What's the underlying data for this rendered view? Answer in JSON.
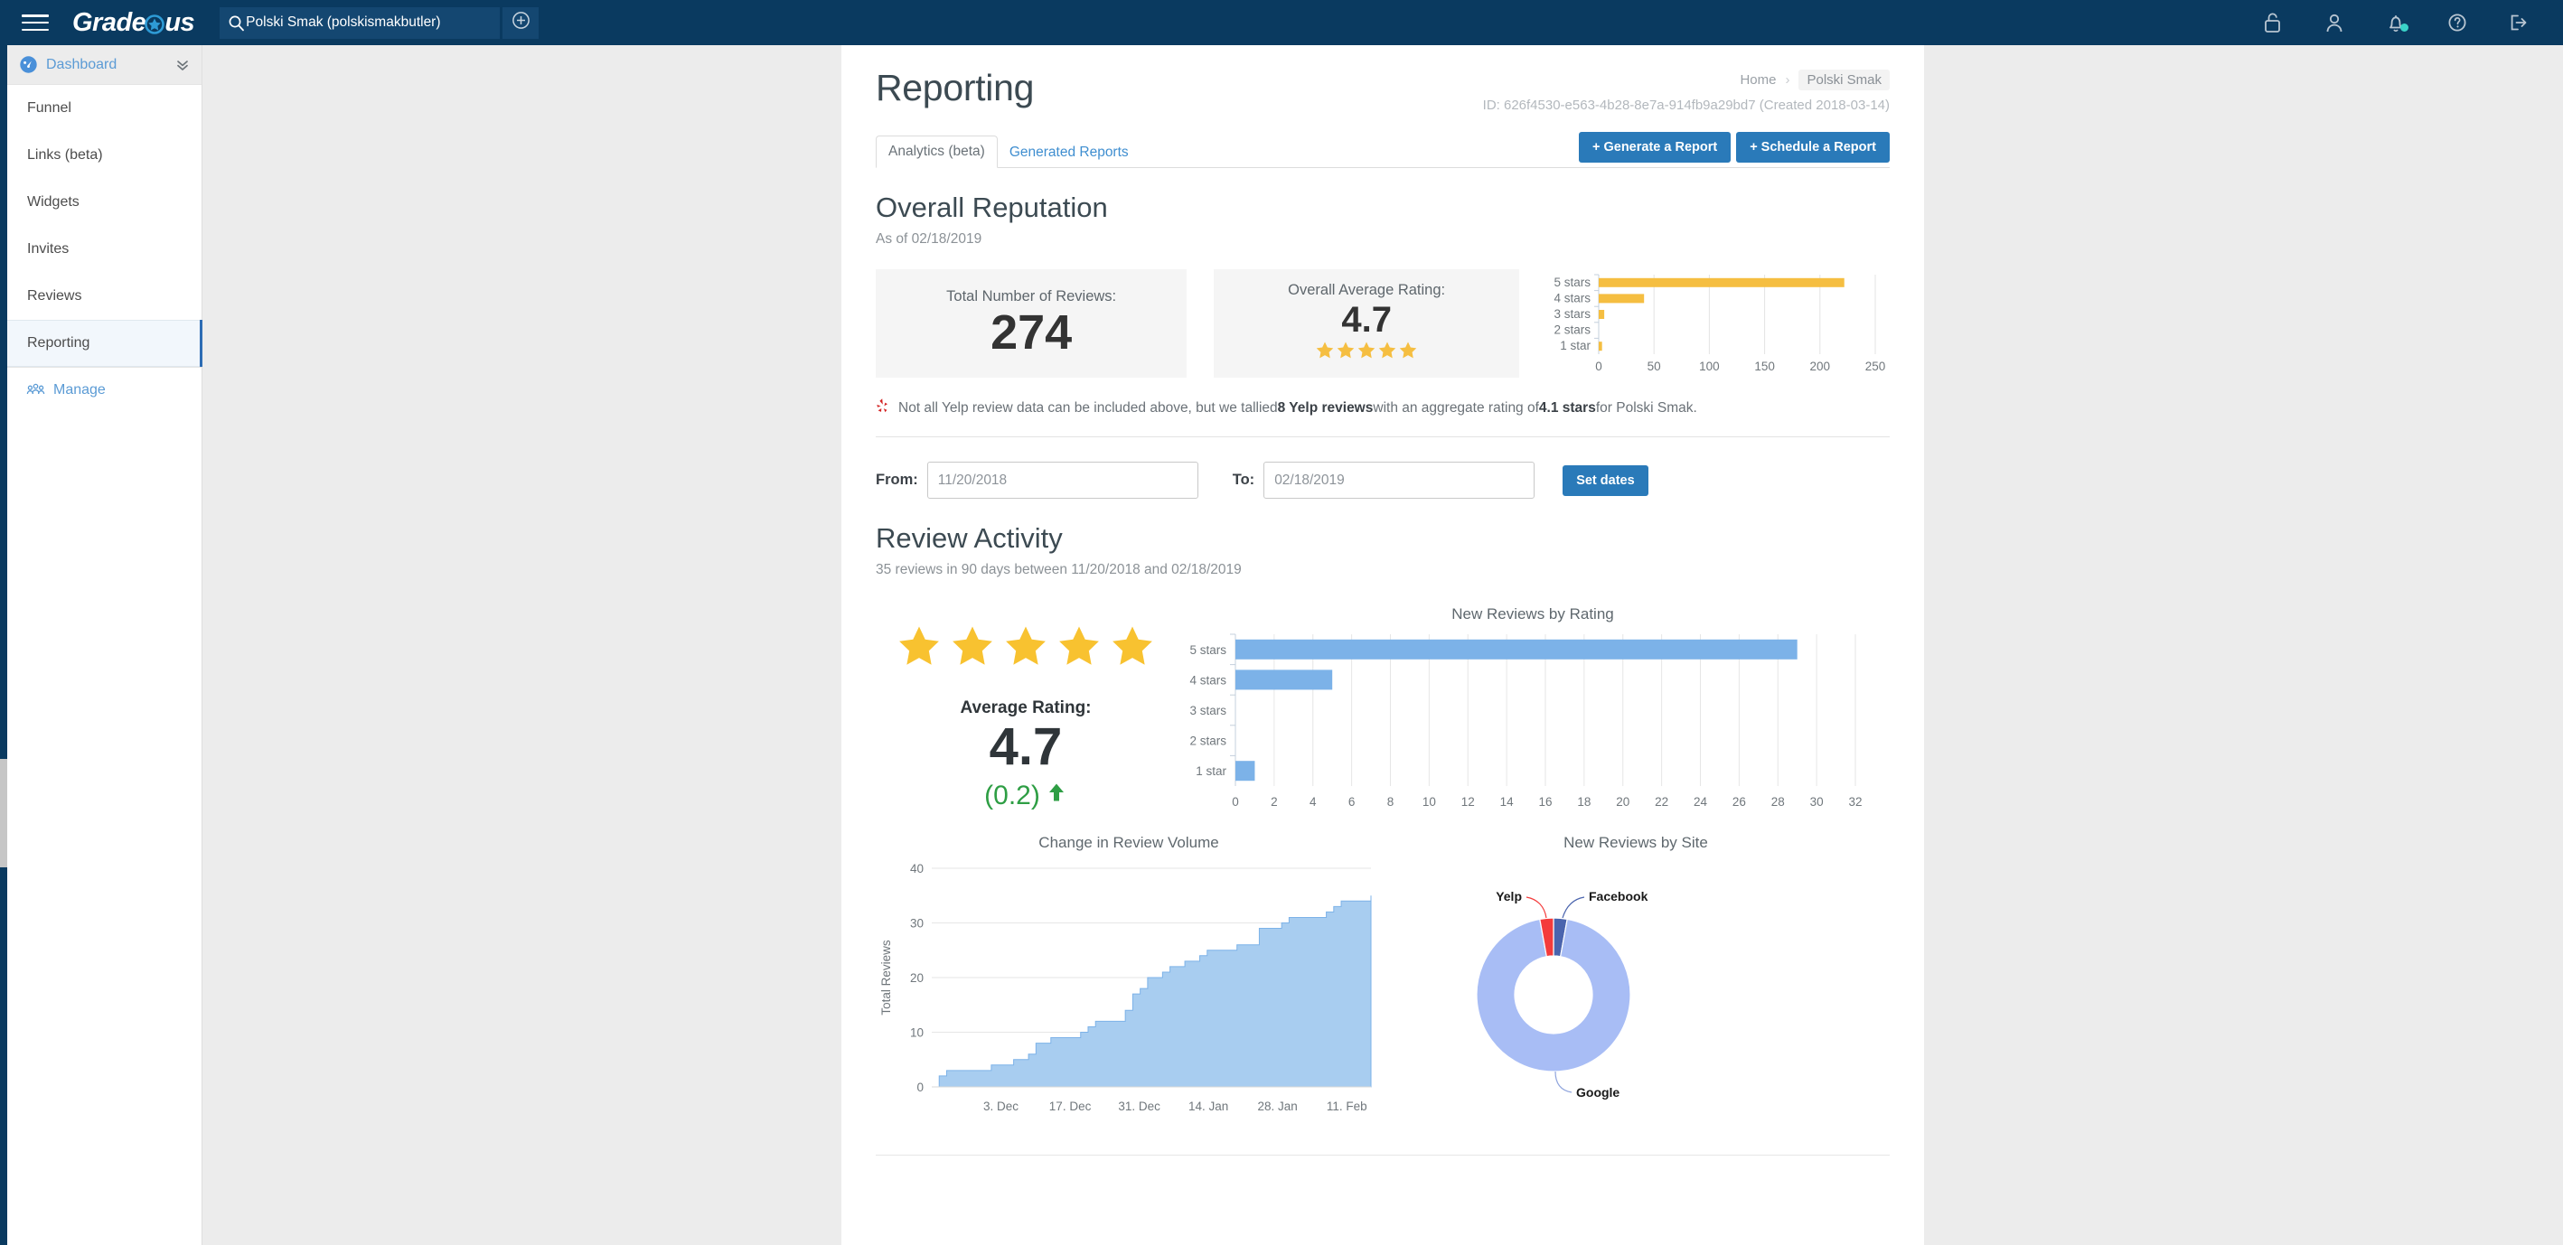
{
  "topnav": {
    "menu_icon": "hamburger-icon",
    "logo_left": "Grade",
    "logo_right": "us",
    "search": {
      "icon": "search-icon",
      "value": "Polski Smak (polskismakbutler)",
      "placeholder": "Search"
    },
    "add_icon": "plus-circle-icon",
    "icons": [
      "unlock-icon",
      "person-icon",
      "bell-icon",
      "help-circle-icon",
      "logout-icon"
    ],
    "bell_badge_color": "#3ad2c8",
    "bg_color": "#0a3a60"
  },
  "sidebar": {
    "header": {
      "label": "Dashboard",
      "icon": "dashboard-gauge-icon",
      "chevron": "chevron-double-down-icon"
    },
    "items": [
      {
        "label": "Funnel",
        "active": false
      },
      {
        "label": "Links (beta)",
        "active": false
      },
      {
        "label": "Widgets",
        "active": false
      },
      {
        "label": "Invites",
        "active": false
      },
      {
        "label": "Reviews",
        "active": false
      },
      {
        "label": "Reporting",
        "active": true
      }
    ],
    "manage": {
      "label": "Manage",
      "icon": "people-group-icon"
    },
    "active_accent": "#2d6cb4"
  },
  "page": {
    "title": "Reporting",
    "breadcrumb": {
      "home": "Home",
      "separator": "›",
      "current": "Polski Smak"
    },
    "id_line": "ID: 626f4530-e563-4b28-8e7a-914fb9a29bd7 (Created 2018-03-14)",
    "tabs": [
      {
        "label": "Analytics (beta)",
        "active": true
      },
      {
        "label": "Generated Reports",
        "active": false
      }
    ],
    "actions": [
      {
        "label": "+ Generate a Report"
      },
      {
        "label": "+ Schedule a Report"
      }
    ],
    "accent_blue": "#2a7ab9"
  },
  "overall_reputation": {
    "heading": "Overall Reputation",
    "subheading": "As of 02/18/2019",
    "cards": [
      {
        "label": "Total Number of Reviews:",
        "value": "274"
      },
      {
        "label": "Overall Average Rating:",
        "value": "4.7",
        "stars": 5
      }
    ],
    "yelp_note": {
      "icon": "yelp-burst-icon",
      "part1": "Not all Yelp review data can be included above, but we tallied ",
      "bold1": "8 Yelp reviews",
      "part2": " with an aggregate rating of ",
      "bold2": "4.1 stars",
      "part3": " for Polski Smak."
    }
  },
  "date_range": {
    "from_label": "From:",
    "from_value": "11/20/2018",
    "to_label": "To:",
    "to_value": "02/18/2019",
    "button": "Set dates"
  },
  "review_activity": {
    "heading": "Review Activity",
    "subheading": "35 reviews in 90 days between 11/20/2018 and 02/18/2019",
    "stars_shown": 5,
    "avg_label": "Average Rating:",
    "avg_value": "4.7",
    "delta_value": "(0.2)",
    "delta_direction": "up",
    "delta_color": "#2e9e44"
  },
  "chart_data": [
    {
      "type": "bar",
      "orientation": "horizontal",
      "name": "overall-reputation-ratings",
      "title": "",
      "categories": [
        "5 stars",
        "4 stars",
        "3 stars",
        "2 stars",
        "1 star"
      ],
      "values": [
        222,
        41,
        5,
        0,
        3
      ],
      "xlabel": "",
      "ylabel": "",
      "xlim": [
        0,
        250
      ],
      "xticks": [
        0,
        50,
        100,
        150,
        200,
        250
      ],
      "bar_color": "#f5be41",
      "grid": true,
      "legend": "none"
    },
    {
      "type": "bar",
      "orientation": "horizontal",
      "name": "new-reviews-by-rating",
      "title": "New Reviews by Rating",
      "categories": [
        "5 stars",
        "4 stars",
        "3 stars",
        "2 stars",
        "1 star"
      ],
      "values": [
        29,
        5,
        0,
        0,
        1
      ],
      "xlabel": "",
      "ylabel": "",
      "xlim": [
        0,
        32
      ],
      "xticks": [
        0,
        2,
        4,
        6,
        8,
        10,
        12,
        14,
        16,
        18,
        20,
        22,
        24,
        26,
        28,
        30,
        32
      ],
      "bar_color": "#7cb2e8",
      "grid": true,
      "legend": "none"
    },
    {
      "type": "area",
      "name": "change-in-review-volume",
      "title": "Change in Review Volume",
      "xlabel": "",
      "ylabel": "Total Reviews",
      "ylim": [
        0,
        40
      ],
      "yticks": [
        0,
        10,
        20,
        30,
        40
      ],
      "xticks": [
        "3. Dec",
        "17. Dec",
        "31. Dec",
        "14. Jan",
        "28. Jan",
        "11. Feb"
      ],
      "fill_color": "#a8cdf0",
      "line_color": "#7cb2e8",
      "grid": true,
      "series": [
        {
          "name": "Total Reviews",
          "values": [
            0,
            2,
            3,
            3,
            3,
            3,
            3,
            3,
            4,
            4,
            4,
            5,
            5,
            6,
            8,
            8,
            9,
            9,
            9,
            9,
            10,
            11,
            12,
            12,
            12,
            12,
            14,
            17,
            18,
            20,
            20,
            21,
            22,
            22,
            23,
            23,
            24,
            25,
            25,
            25,
            25,
            26,
            26,
            26,
            29,
            29,
            29,
            30,
            31,
            31,
            31,
            31,
            31,
            32,
            33,
            34,
            34,
            34,
            34,
            35
          ]
        }
      ]
    },
    {
      "type": "pie",
      "subtype": "donut",
      "name": "new-reviews-by-site",
      "title": "New Reviews by Site",
      "labels": [
        "Google",
        "Yelp",
        "Facebook"
      ],
      "values": [
        33,
        1,
        1
      ],
      "colors": [
        "#a8bdf5",
        "#f43b3b",
        "#4a64ad"
      ],
      "legend": "outside-labels"
    }
  ]
}
